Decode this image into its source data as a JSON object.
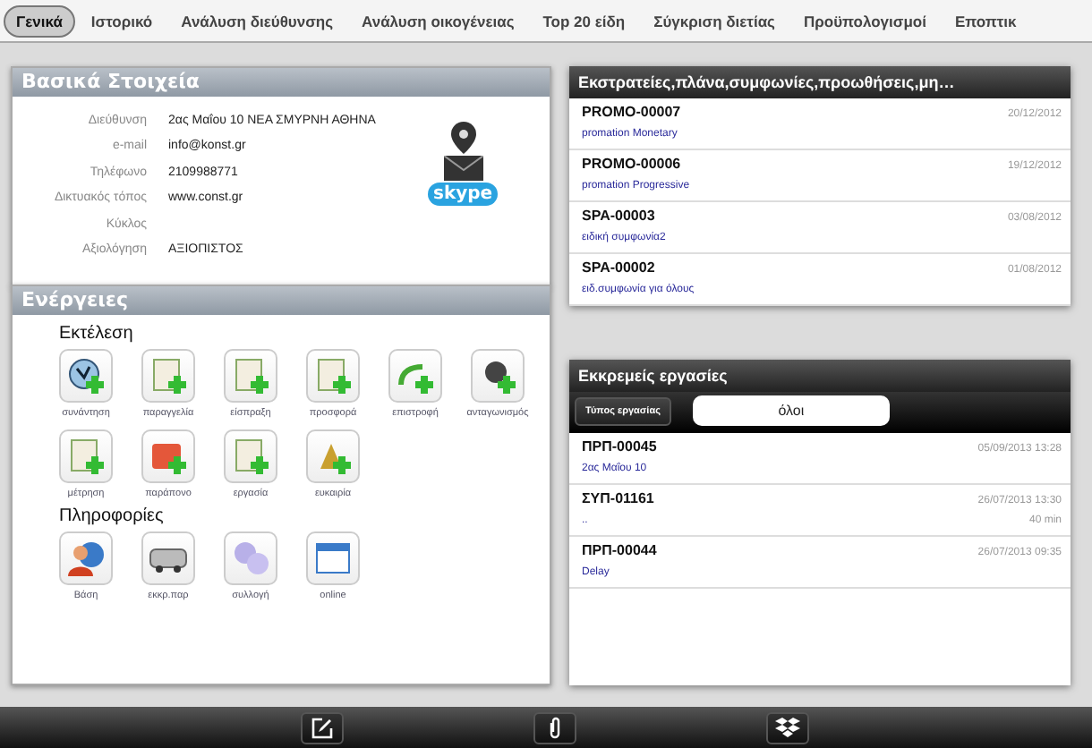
{
  "tabs": [
    {
      "label": "Γενικά",
      "selected": true
    },
    {
      "label": "Ιστορικό",
      "selected": false
    },
    {
      "label": "Ανάλυση διεύθυνσης",
      "selected": false
    },
    {
      "label": "Ανάλυση οικογένειας",
      "selected": false
    },
    {
      "label": "Top 20 είδη",
      "selected": false
    },
    {
      "label": "Σύγκριση διετίας",
      "selected": false
    },
    {
      "label": "Προϋπολογισμοί",
      "selected": false
    },
    {
      "label": "Εποπτικ",
      "selected": false
    }
  ],
  "basic_info": {
    "title": "Βασικά Στοιχεία",
    "skype_label": "skype",
    "fields": [
      {
        "label": "Διεύθυνση",
        "value": "2ας Μαΐου 10 ΝΕΑ ΣΜΥΡΝΗ ΑΘΗΝΑ"
      },
      {
        "label": "e-mail",
        "value": "info@konst.gr"
      },
      {
        "label": "Τηλέφωνο",
        "value": "2109988771"
      },
      {
        "label": "Δικτυακός τόπος",
        "value": "www.const.gr"
      },
      {
        "label": "Κύκλος"
      },
      {
        "label": "Αξιολόγηση",
        "value": "ΑΞΙΟΠΙΣΤΟΣ"
      }
    ]
  },
  "actions": {
    "title": "Ενέργειες",
    "groups": [
      {
        "title": "Εκτέλεση",
        "items": [
          {
            "label": "συνάντηση"
          },
          {
            "label": "παραγγελία"
          },
          {
            "label": "είσπραξη"
          },
          {
            "label": "προσφορά"
          },
          {
            "label": "επιστροφή"
          },
          {
            "label": "ανταγωνισμός"
          },
          {
            "label": "μέτρηση"
          },
          {
            "label": "παράπονο"
          },
          {
            "label": "εργασία"
          },
          {
            "label": "ευκαιρία"
          }
        ]
      },
      {
        "title": "Πληροφορίες",
        "items": [
          {
            "label": "Βάση"
          },
          {
            "label": "εκκρ.παρ"
          },
          {
            "label": "συλλογή"
          },
          {
            "label": "online"
          }
        ]
      }
    ]
  },
  "campaigns": {
    "title": "Εκστρατείες,πλάνα,συμφωνίες,προωθήσεις,μη…",
    "items": [
      {
        "code": "PROMO-00007",
        "description": "promation Monetary",
        "date": "20/12/2012"
      },
      {
        "code": "PROMO-00006",
        "description": "promation Progressive",
        "date": "19/12/2012"
      },
      {
        "code": "SPA-00003",
        "description": "ειδική συμφωνία2",
        "date": "03/08/2012"
      },
      {
        "code": "SPA-00002",
        "description": "ειδ.συμφωνία για όλους",
        "date": "01/08/2012"
      }
    ]
  },
  "pending_tasks": {
    "title": "Εκκρεμείς εργασίες",
    "filter_button": "Τύπος εργασίας",
    "filter_value": "όλοι",
    "items": [
      {
        "code": "ΠΡΠ-00045",
        "description": "2ας Μαΐου 10",
        "datetime": "05/09/2013 13:28"
      },
      {
        "code": "ΣΥΠ-01161",
        "description": "..",
        "datetime": "26/07/2013 13:30",
        "duration": "40 min"
      },
      {
        "code": "ΠΡΠ-00044",
        "description": "Delay",
        "datetime": "26/07/2013 09:35"
      }
    ]
  }
}
